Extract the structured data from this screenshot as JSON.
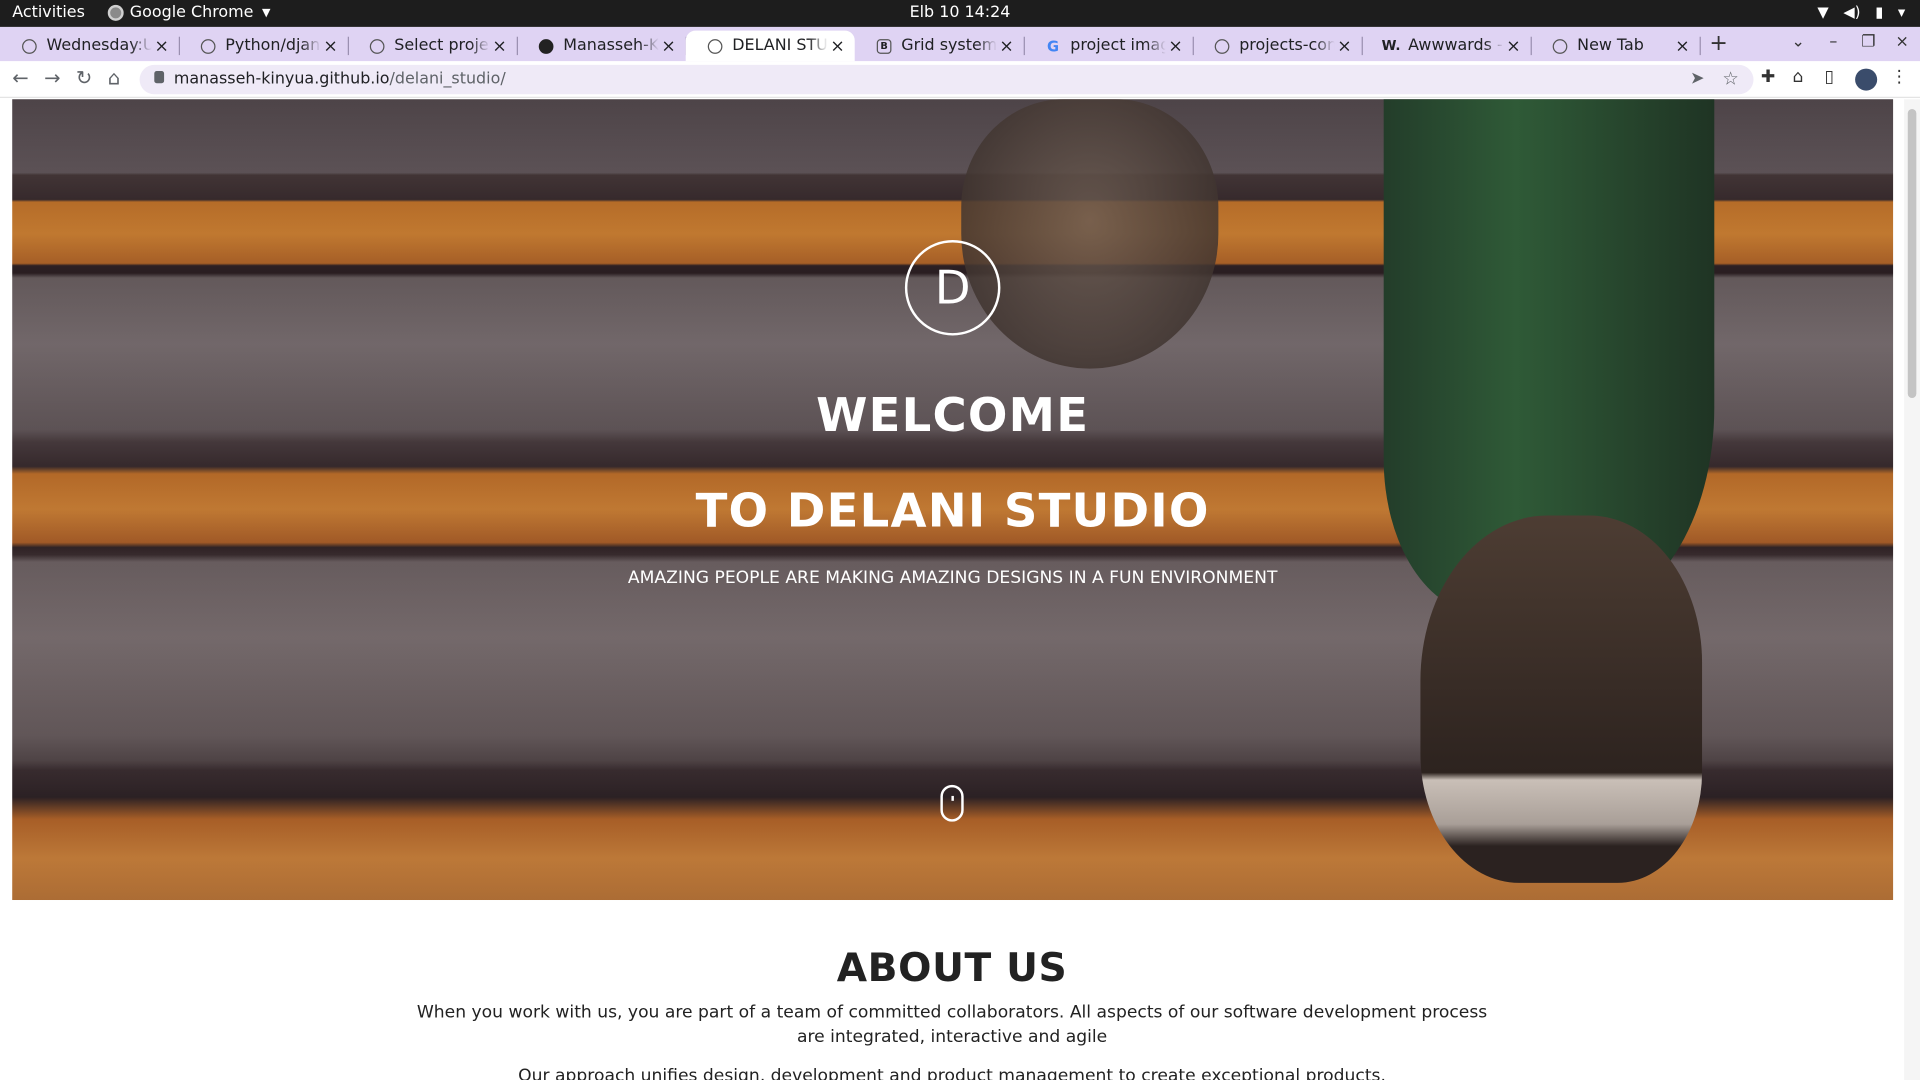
{
  "system_bar": {
    "activities": "Activities",
    "app_name": "Google Chrome",
    "clock": "Elb 10  14:24"
  },
  "tabs": [
    {
      "title": "Wednesday:Up",
      "icon": "pin-icon"
    },
    {
      "title": "Python/django",
      "icon": "pin-icon"
    },
    {
      "title": "Select project t",
      "icon": "globe-icon"
    },
    {
      "title": "Manasseh-Kiny",
      "icon": "github-icon"
    },
    {
      "title": "DELANI STUDIO",
      "icon": "globe-icon",
      "active": true
    },
    {
      "title": "Grid system · B",
      "icon": "bootstrap-icon"
    },
    {
      "title": "project images",
      "icon": "google-icon"
    },
    {
      "title": "projects-conce",
      "icon": "globe-icon"
    },
    {
      "title": "Awwwards - W",
      "icon": "awwwards-icon"
    },
    {
      "title": "New Tab",
      "icon": "chrome-icon"
    }
  ],
  "address_bar": {
    "host": "manasseh-kinyua.github.io",
    "path": "/delani_studio/"
  },
  "hero": {
    "logo_letter": "D",
    "heading_line1": "WELCOME",
    "heading_line2": "TO DELANI STUDIO",
    "tagline": "AMAZING PEOPLE ARE MAKING AMAZING DESIGNS IN A FUN ENVIRONMENT"
  },
  "about": {
    "title": "ABOUT US",
    "paragraph1": "When you work with us, you are part of a team of committed collaborators. All aspects of our software development process are integrated, interactive and agile",
    "paragraph2": "Our approach unifies design, development and product management to create exceptional products."
  },
  "colors": {
    "tab_strip": "#dfd3f3",
    "omnibox": "#efeaf7",
    "accent_orange": "#f39a36"
  }
}
